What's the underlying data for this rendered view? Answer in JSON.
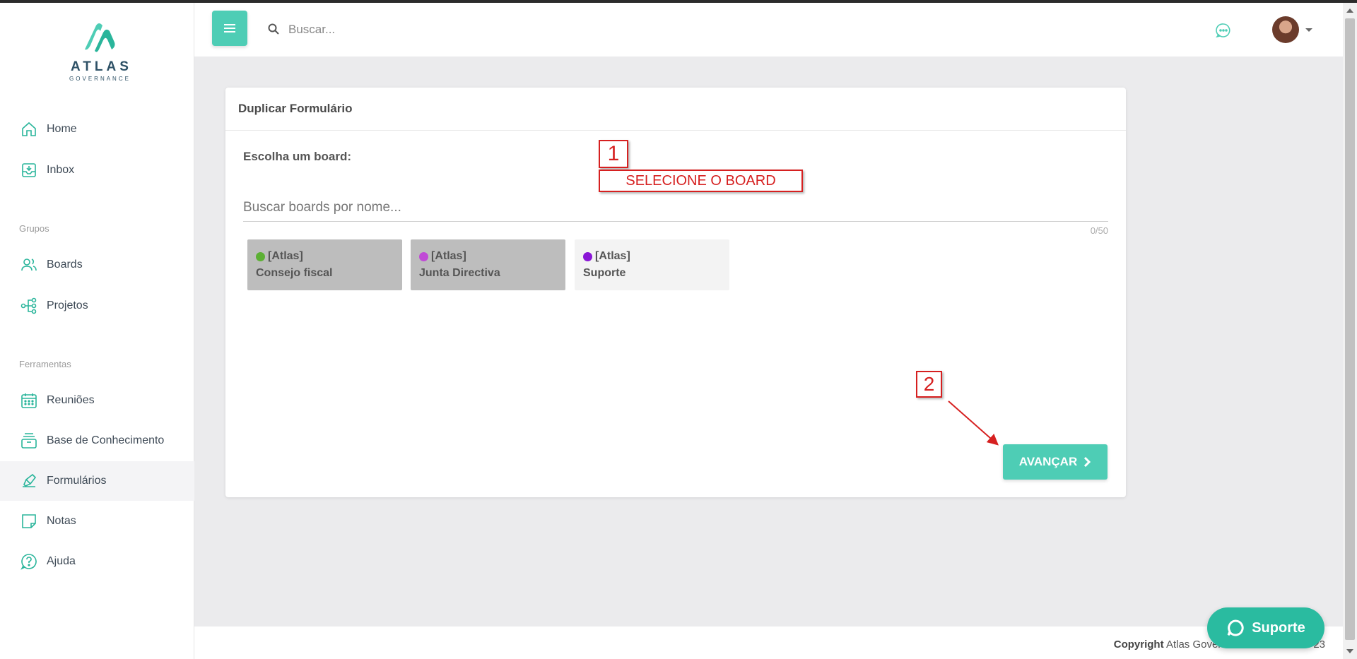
{
  "brand": {
    "name": "ATLAS",
    "subtitle": "GOVERNANCE",
    "accent": "#4ecdb5"
  },
  "sidebar": {
    "items": [
      {
        "label": "Home",
        "icon": "home-icon"
      },
      {
        "label": "Inbox",
        "icon": "inbox-icon"
      }
    ],
    "groups_section": "Grupos",
    "group_items": [
      {
        "label": "Boards",
        "icon": "users-icon"
      },
      {
        "label": "Projetos",
        "icon": "project-tree-icon"
      }
    ],
    "tools_section": "Ferramentas",
    "tool_items": [
      {
        "label": "Reuniões",
        "icon": "calendar-icon"
      },
      {
        "label": "Base de Conhecimento",
        "icon": "archive-icon"
      },
      {
        "label": "Formulários",
        "icon": "form-pen-icon",
        "active": true
      },
      {
        "label": "Notas",
        "icon": "note-icon"
      },
      {
        "label": "Ajuda",
        "icon": "help-icon"
      }
    ]
  },
  "header": {
    "search_placeholder": "Buscar..."
  },
  "card": {
    "title": "Duplicar Formulário",
    "choose_label": "Escolha um board:",
    "search_placeholder": "Buscar boards por nome...",
    "counter": "0/50",
    "boards": [
      {
        "tag": "[Atlas]",
        "name": "Consejo fiscal",
        "dot_color": "#5cb034",
        "selected": true
      },
      {
        "tag": "[Atlas]",
        "name": "Junta Directiva",
        "dot_color": "#c04ad6",
        "selected": true
      },
      {
        "tag": "[Atlas]",
        "name": "Suporte",
        "dot_color": "#8a16d6",
        "selected": false
      }
    ],
    "advance_label": "AVANÇAR"
  },
  "annotations": {
    "step1_number": "1",
    "step1_text": "SELECIONE O BOARD",
    "step2_number": "2",
    "color": "#d62020"
  },
  "footer": {
    "copyright_bold": "Copyright",
    "copyright_text": "Atlas Gover",
    "year_tail": "23"
  },
  "support": {
    "label": "Suporte"
  }
}
